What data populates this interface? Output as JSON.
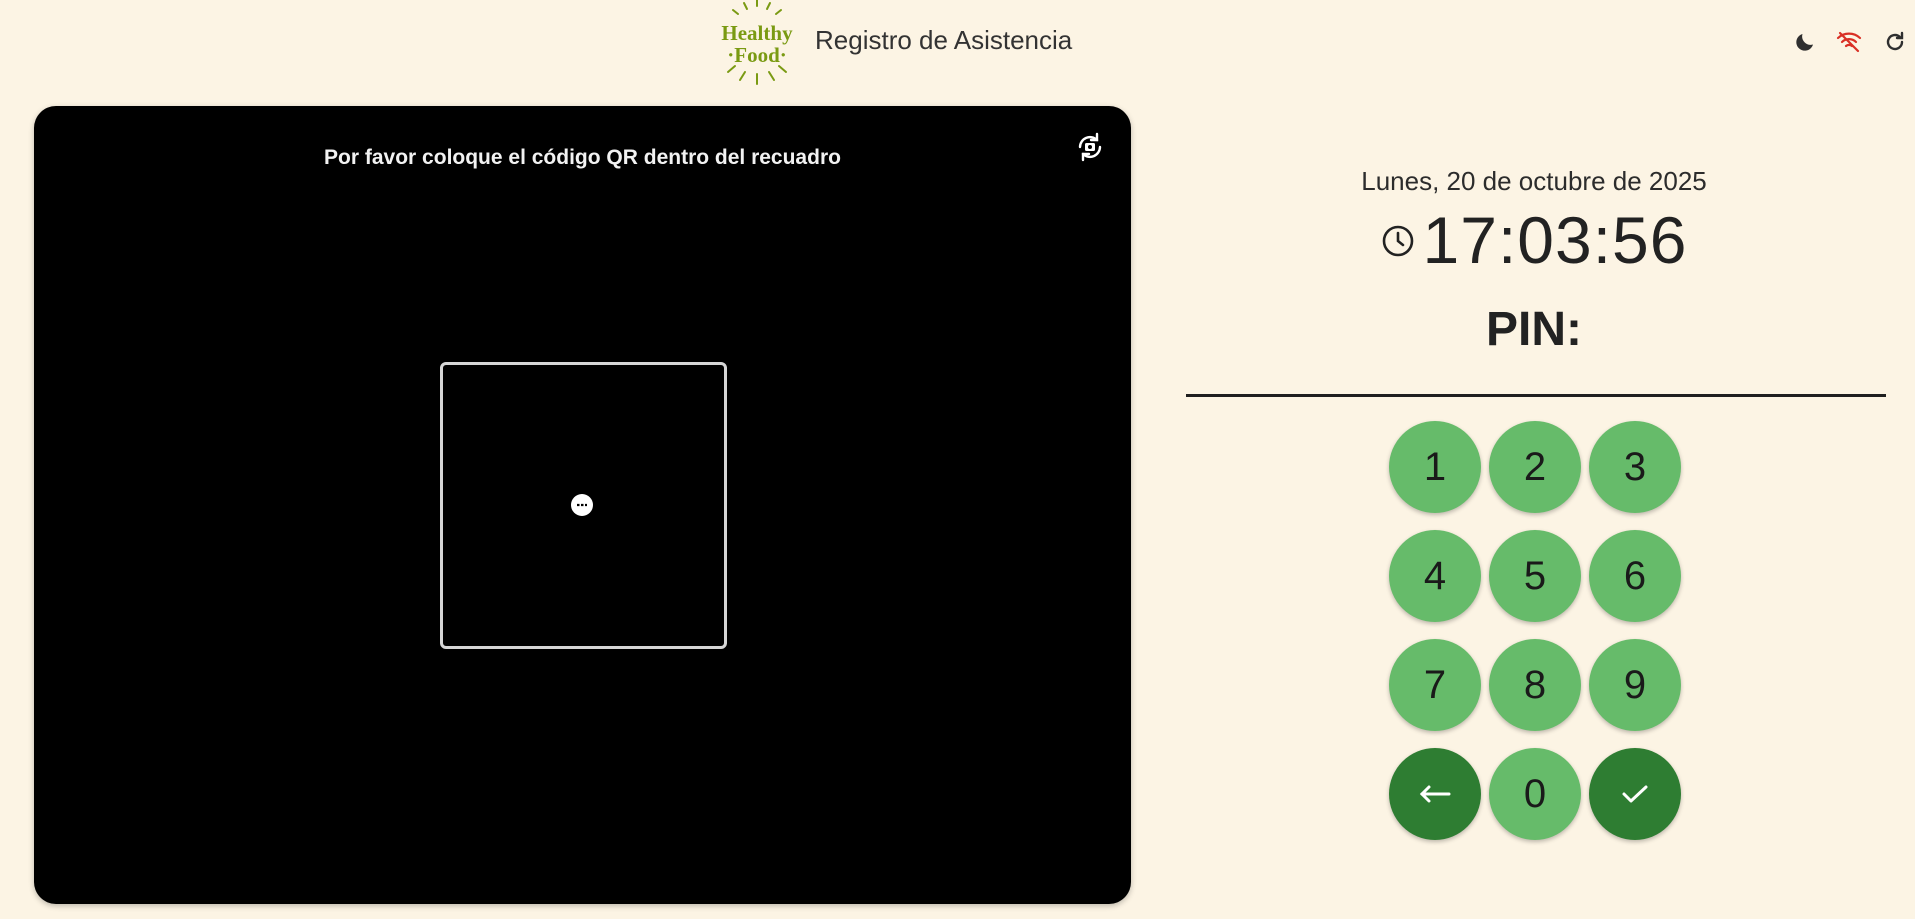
{
  "header": {
    "logo_text_top": "Healthy",
    "logo_text_bottom": "·Food·",
    "title": "Registro de Asistencia",
    "icons": [
      "moon-icon",
      "wifi-off-icon",
      "refresh-icon"
    ]
  },
  "camera": {
    "instruction": "Por favor coloque el código QR dentro del recuadro"
  },
  "clock": {
    "date": "Lunes, 20 de octubre de 2025",
    "time": "17:03:56"
  },
  "pin": {
    "label": "PIN:",
    "value": ""
  },
  "keypad": {
    "keys": [
      "1",
      "2",
      "3",
      "4",
      "5",
      "6",
      "7",
      "8",
      "9",
      "←",
      "0",
      "✓"
    ]
  },
  "colors": {
    "background": "#fcf4e4",
    "key_light": "#66bb6a",
    "key_dark": "#2e7d32",
    "logo_green": "#7a9a12",
    "wifi_off_red": "#d93025"
  }
}
